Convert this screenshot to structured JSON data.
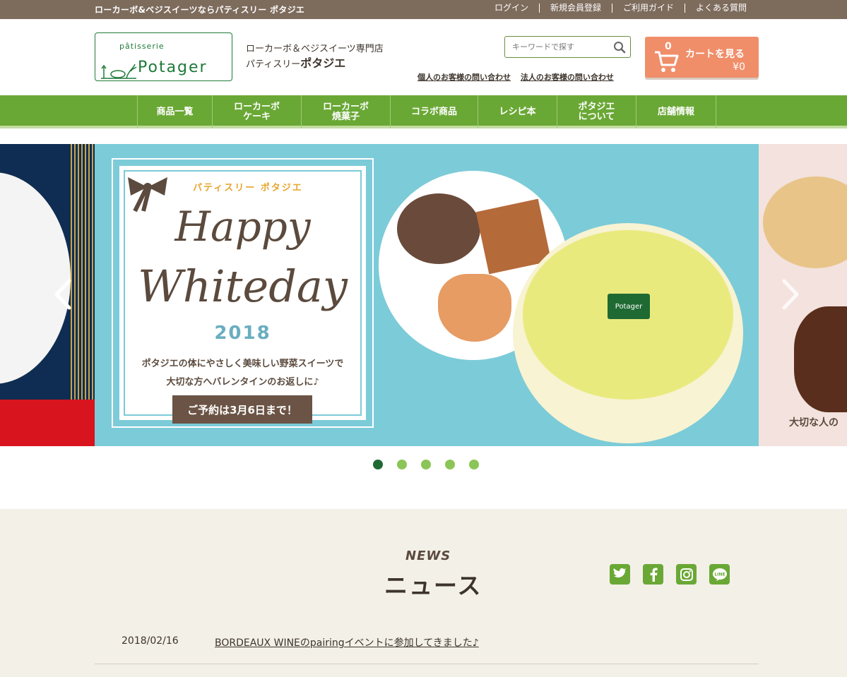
{
  "topbar": {
    "tagline": "ローカーボ&ベジスイーツならパティスリー ポタジエ",
    "links": [
      "ログイン",
      "新規会員登録",
      "ご利用ガイド",
      "よくある質問"
    ]
  },
  "header": {
    "logo_small": "pâtisserie",
    "logo_big": "Potager",
    "shop_line1": "ローカーボ＆ベジスイーツ専門店",
    "shop_line2_prefix": "パティスリー",
    "shop_line2_name": "ポタジエ",
    "search_placeholder": "キーワードで探す",
    "contact_personal": "個人のお客様の問い合わせ",
    "contact_business": "法人のお客様の問い合わせ",
    "cart_count": "0",
    "cart_label": "カートを見る",
    "cart_price": "¥0"
  },
  "nav": [
    {
      "line1": "商品一覧",
      "line2": ""
    },
    {
      "line1": "ローカーボ",
      "line2": "ケーキ"
    },
    {
      "line1": "ローカーボ",
      "line2": "焼菓子"
    },
    {
      "line1": "コラボ商品",
      "line2": ""
    },
    {
      "line1": "レシピ本",
      "line2": ""
    },
    {
      "line1": "ポタジエ",
      "line2": "について"
    },
    {
      "line1": "店舗情報",
      "line2": ""
    }
  ],
  "hero": {
    "brand": "パティスリー ポタジエ",
    "title_line1": "Happy",
    "title_line2": "Whiteday",
    "year": "2018",
    "copy_line1": "ポタジエの体にやさしく美味しい野菜スイーツで",
    "copy_line2": "大切な方へバレンタインのお返しに♪",
    "reserve_button": "ご予約は3月6日まで！",
    "cake_tag": "Potager",
    "right_caption": "大切な人の",
    "dots_count": 5,
    "active_dot": 0
  },
  "news": {
    "heading_en": "NEWS",
    "heading_ja": "ニュース",
    "social": [
      "twitter",
      "facebook",
      "instagram",
      "line"
    ],
    "items": [
      {
        "date": "2018/02/16",
        "title": "BORDEAUX WINEのpairingイベントに参加してきました♪"
      }
    ]
  },
  "colors": {
    "topbar": "#7d6b5c",
    "nav_green": "#6aa835",
    "cart": "#f08e6a",
    "hero_blue": "#7ccbd8",
    "dark_green": "#1f6a33"
  }
}
